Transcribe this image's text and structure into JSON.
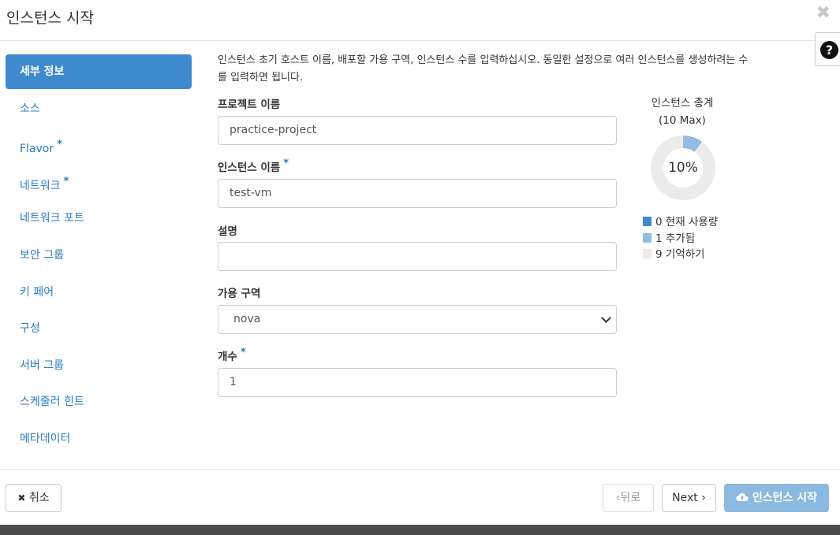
{
  "modal": {
    "title": "인스턴스 시작"
  },
  "sidebar": {
    "items": [
      {
        "label": "세부 정보",
        "required": false,
        "active": true
      },
      {
        "label": "소스",
        "required": false
      },
      {
        "label": "Flavor",
        "required": true
      },
      {
        "label": "네트워크",
        "required": true
      },
      {
        "label": "네트워크 포트",
        "required": false
      },
      {
        "label": "보안 그룹",
        "required": false
      },
      {
        "label": "키 페어",
        "required": false
      },
      {
        "label": "구성",
        "required": false
      },
      {
        "label": "서버 그룹",
        "required": false
      },
      {
        "label": "스케줄러 힌트",
        "required": false
      },
      {
        "label": "메타데이터",
        "required": false
      }
    ],
    "required_marker": "*"
  },
  "main": {
    "help_line1": "인스턴스 초기 호스트 이름, 배포할 가용 구역, 인스턴스 수를 입력하십시오. 동일한 설정으로 여러 인스턴스를 생성하려는 수",
    "help_line2": "를 입력하면 됩니다.",
    "project_label": "프로젝트 이름",
    "project_value": "practice-project",
    "instance_name_label": "인스턴스 이름",
    "instance_name_value": "test-vm",
    "description_label": "설명",
    "description_value": "",
    "az_label": "가용 구역",
    "az_value": "nova",
    "count_label": "개수",
    "count_value": "1",
    "required_marker": "*"
  },
  "chart_data": {
    "type": "pie",
    "title_line1": "인스턴스 총계",
    "title_line2": "(10 Max)",
    "center_label": "10%",
    "slices": [
      {
        "label": "현재 사용량",
        "value": 0,
        "color": "#3f8ace"
      },
      {
        "label": "추가됨",
        "value": 1,
        "color": "#92bce2"
      },
      {
        "label": "기억하기",
        "value": 9,
        "color": "#ebebeb"
      }
    ]
  },
  "footer": {
    "cancel_label": "취소",
    "back_label": "뒤로",
    "next_label": "Next",
    "launch_label": "인스턴스 시작"
  },
  "colors": {
    "accent": "#3f8ace",
    "accent_light": "#8cb9e0",
    "link": "#2a7bbd"
  }
}
